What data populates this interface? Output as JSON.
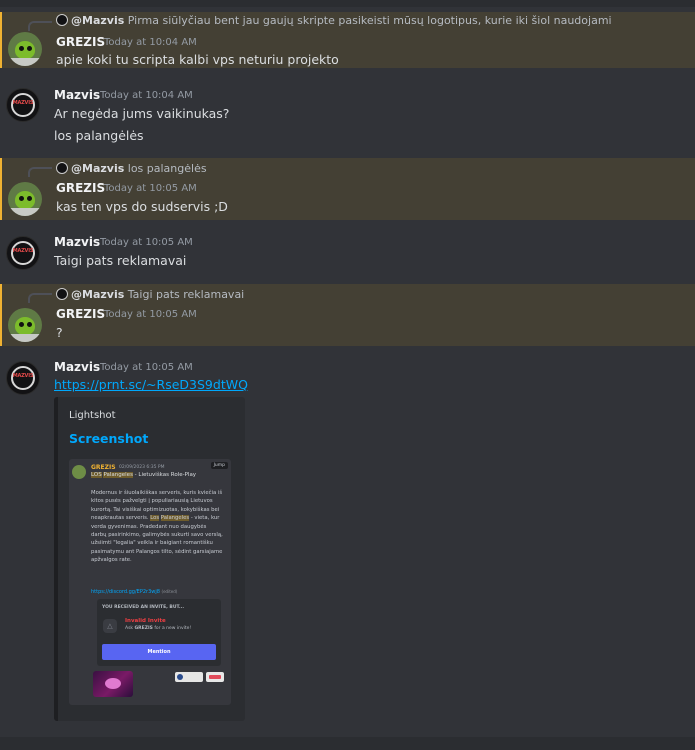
{
  "messages": [
    {
      "author": "GREZIS",
      "time": "Today at 10:04 AM",
      "text": "apie koki tu scripta kalbi vps neturiu projekto",
      "reply": {
        "author": "@Mazvis",
        "text": "Pirma siūlyčiau bent jau gaujų skripte pasikeisti mūsų logotipus, kurie iki šiol naudojami"
      }
    },
    {
      "author": "Mazvis",
      "time": "Today at 10:04 AM",
      "lines": [
        "Ar negėda jums vaikinukas?",
        "los palangėlės"
      ]
    },
    {
      "author": "GREZIS",
      "time": "Today at 10:05 AM",
      "text": "kas ten vps do sudservis ;D",
      "reply": {
        "author": "@Mazvis",
        "text": "los palangėlės"
      }
    },
    {
      "author": "Mazvis",
      "time": "Today at 10:05 AM",
      "text": "Taigi pats reklamavai"
    },
    {
      "author": "GREZIS",
      "time": "Today at 10:05 AM",
      "text": "?",
      "reply": {
        "author": "@Mazvis",
        "text": "Taigi pats reklamavai"
      }
    },
    {
      "author": "Mazvis",
      "time": "Today at 10:05 AM",
      "link": "https://prnt.sc/~RseD3S9dtWQ",
      "embed": {
        "provider": "Lightshot",
        "title": "Screenshot"
      }
    }
  ],
  "embed_image": {
    "author": "GREZIS",
    "date": "02/09/2023 6:35 PM",
    "jump": "Jump",
    "line1_pre": "",
    "line1_mark1": "LOS",
    "line1_mark2": "Palangeles",
    "line1_post": " - Lietuviškas Role-Play",
    "para_pre": "Modernus ir šiuolaikiškas serveris, kuris kviečia iš kitos pusės pažvelgti į populiariausią Lietuvos kurortą. Tai visiškai optimizuotas, kokybiškas bei neapkrautas serveris. ",
    "para_mark1": "Los",
    "para_mark2": "Palangeles",
    "para_post": " - vieta, kur verda gyvenimas. Pradedant nuo daugybės darbų pasirinkimo, galimybės sukurti savo verslą, užsiimti \"legalia\" veikla ir baigiant romantišku pasimatymu ant Palangos tilto, sėdint garsiajame apžvalgos rate.",
    "invite_link": "https://discord.gg/EP2r3wj8",
    "edited": "(edited)",
    "invite_header": "YOU RECEIVED AN INVITE, BUT...",
    "invite_title": "Invalid Invite",
    "invite_sub_pre": "Ask ",
    "invite_sub_name": "GREZIS",
    "invite_sub_post": " for a new invite!",
    "invite_button": "Mention"
  },
  "colors": {
    "background": "#313338",
    "highlight": "#444034",
    "highlight_bar": "#f0b232",
    "link": "#00a8fc",
    "mention_button": "#5865f2",
    "invalid": "#f23f43"
  }
}
